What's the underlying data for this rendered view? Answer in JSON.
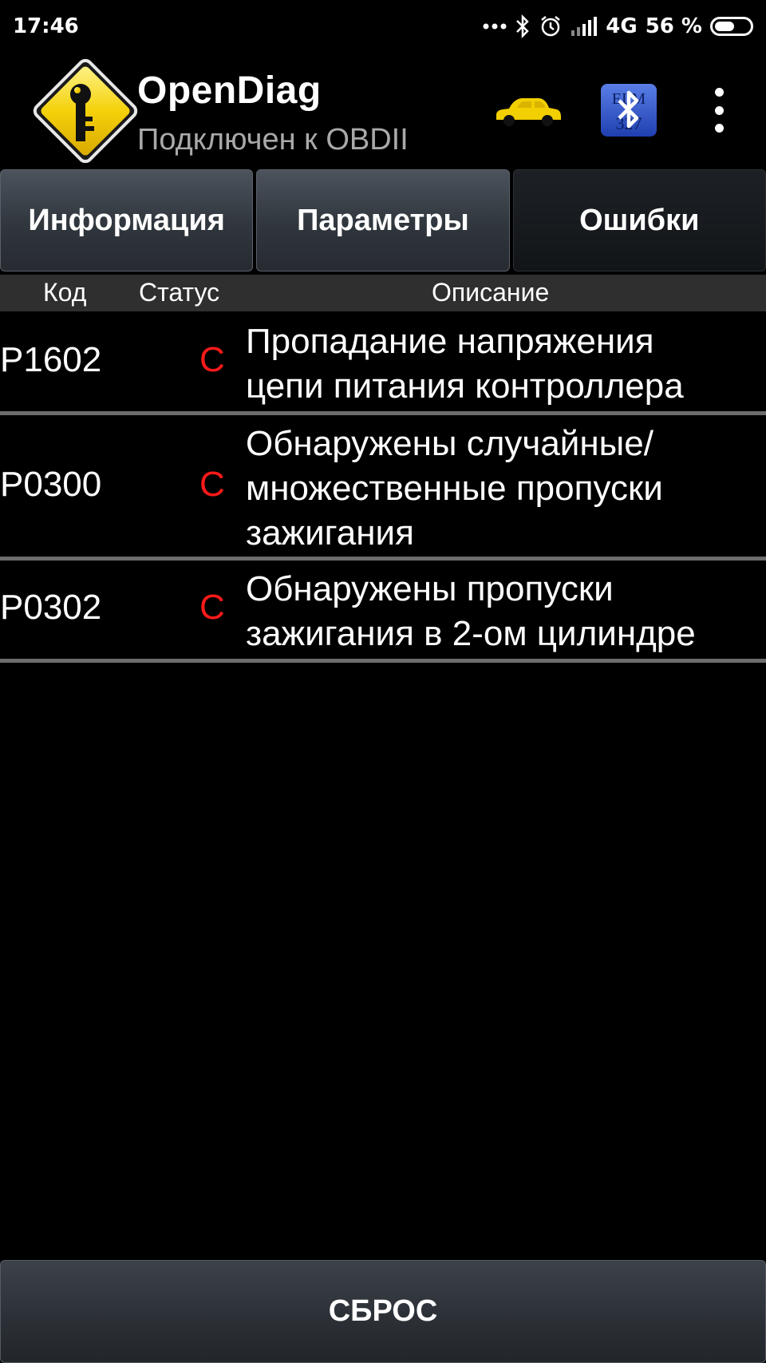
{
  "status_bar": {
    "time": "17:46",
    "network": "4G",
    "battery": "56 %",
    "battery_level": 0.56
  },
  "header": {
    "title": "OpenDiag",
    "subtitle": "Подключен к OBDII",
    "logo_icon": "key-warning-sign-icon",
    "car_icon": "car-icon",
    "bluetooth_icon": "elm327-bluetooth-icon",
    "menu_icon": "more-vert-icon",
    "elm_text": "ELM 327"
  },
  "tabs": [
    {
      "label": "Информация",
      "active": false
    },
    {
      "label": "Параметры",
      "active": false
    },
    {
      "label": "Ошибки",
      "active": true
    }
  ],
  "table": {
    "headers": {
      "code": "Код",
      "status": "Статус",
      "description": "Описание"
    },
    "rows": [
      {
        "code": "P1602",
        "status": "C",
        "description": [
          "Пропадание напряжения",
          "цепи питания контроллера"
        ]
      },
      {
        "code": "P0300",
        "status": "C",
        "description": [
          "Обнаружены случайные/",
          "множественные пропуски",
          "зажигания"
        ]
      },
      {
        "code": "P0302",
        "status": "C",
        "description": [
          "Обнаружены пропуски",
          "зажигания в 2-ом цилиндре"
        ]
      }
    ]
  },
  "reset_button": {
    "label": "СБРОС"
  },
  "colors": {
    "status_error": "#ff1a1a",
    "car": "#f2cf00",
    "logo": "#f4d10a"
  }
}
